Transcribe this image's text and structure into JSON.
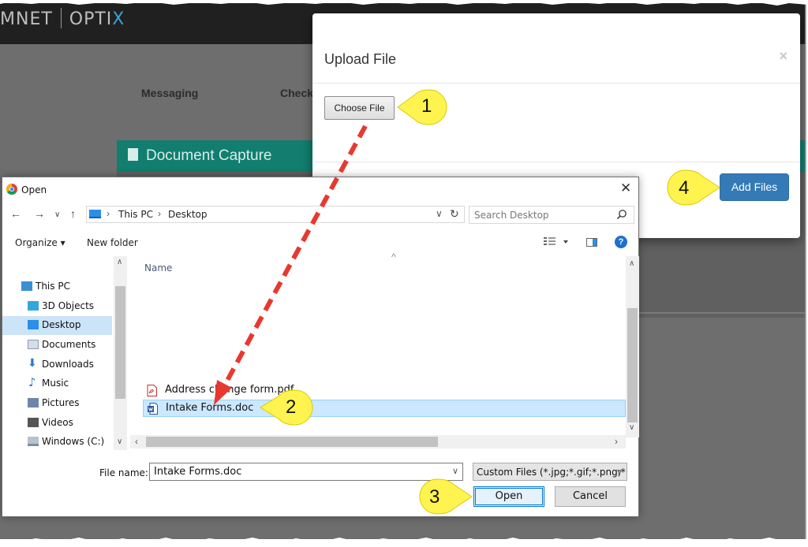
{
  "app": {
    "logo_left": "MNET",
    "logo_right_a": "OPTI",
    "logo_right_b": "X",
    "nav": [
      "Messaging",
      "Check"
    ],
    "section_title": "Document Capture"
  },
  "upload_modal": {
    "title": "Upload File",
    "close": "×",
    "choose_file": "Choose File",
    "add_files": "Add Files"
  },
  "dialog": {
    "title": "Open",
    "close": "✕",
    "breadcrumbs": [
      "This PC",
      "Desktop"
    ],
    "search_placeholder": "Search Desktop",
    "organize": "Organize ▾",
    "new_folder": "New folder",
    "help": "?",
    "tree": [
      {
        "label": "This PC",
        "icon": "computer-icon",
        "color": "#3b8fd6"
      },
      {
        "label": "3D Objects",
        "icon": "cube-icon",
        "color": "#35a6d9"
      },
      {
        "label": "Desktop",
        "icon": "desktop-icon",
        "color": "#2b8ee8",
        "selected": true
      },
      {
        "label": "Documents",
        "icon": "documents-icon",
        "color": "#8a9bb0"
      },
      {
        "label": "Downloads",
        "icon": "download-icon",
        "color": "#2b78d0"
      },
      {
        "label": "Music",
        "icon": "music-icon",
        "color": "#2b78d0"
      },
      {
        "label": "Pictures",
        "icon": "pictures-icon",
        "color": "#6d86a8"
      },
      {
        "label": "Videos",
        "icon": "videos-icon",
        "color": "#555555"
      },
      {
        "label": "Windows (C:)",
        "icon": "drive-icon",
        "color": "#7f8c99"
      }
    ],
    "column_name": "Name",
    "files": [
      {
        "name": "Address change form.pdf",
        "icon": "pdf-icon"
      },
      {
        "name": "Intake Forms.doc",
        "icon": "word-icon",
        "selected": true
      }
    ],
    "filename_label": "File name:",
    "filename_value": "Intake Forms.doc",
    "filter": "Custom Files (*.jpg;*.gif;*.png;*.",
    "open": "Open",
    "cancel": "Cancel"
  },
  "callouts": [
    "1",
    "2",
    "3",
    "4"
  ],
  "colors": {
    "callout_fill": "#fff44f",
    "arrow": "#e8392e",
    "primary": "#337ab7",
    "teal": "#117e6f"
  }
}
